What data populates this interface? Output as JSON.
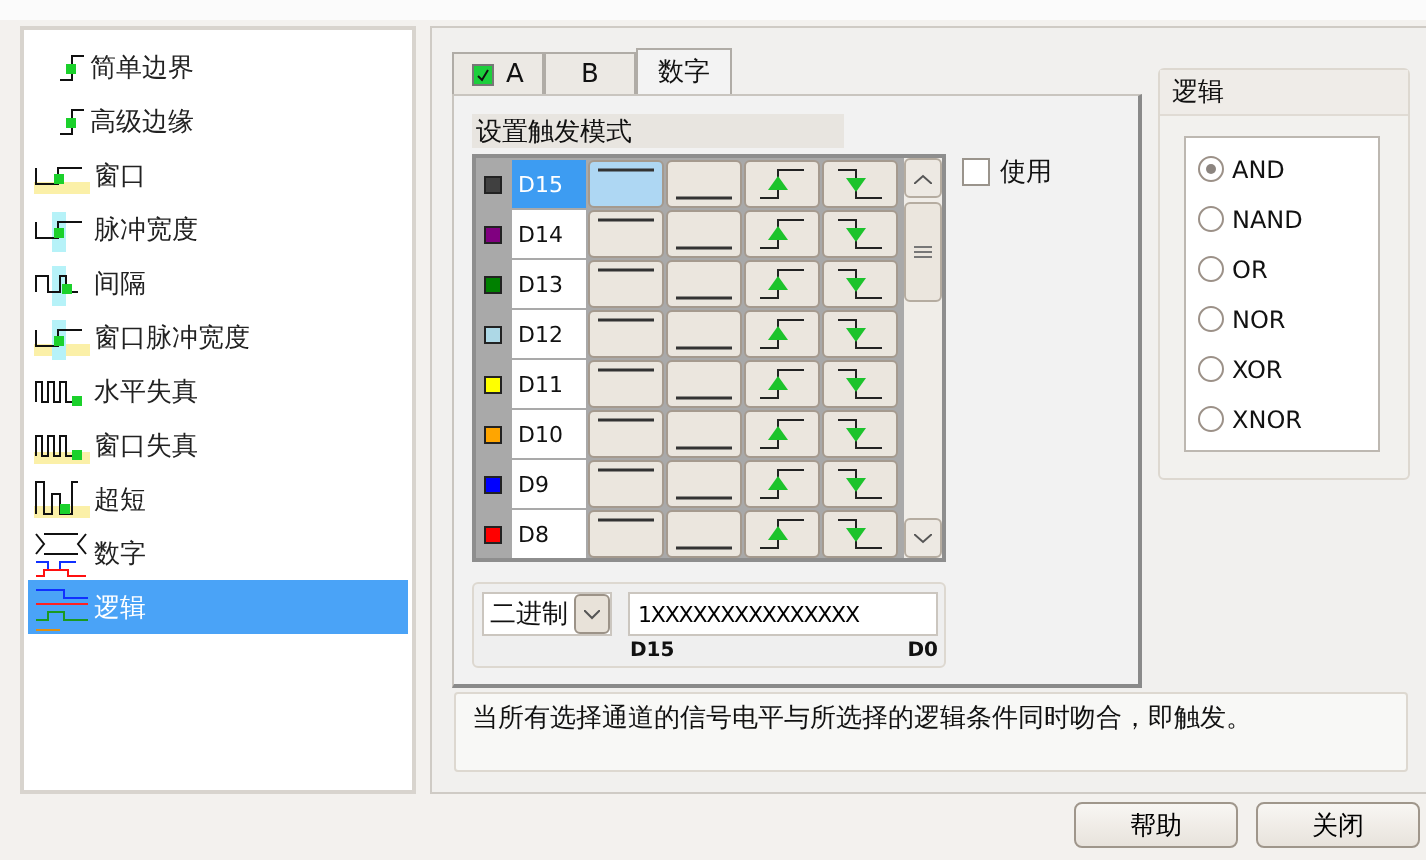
{
  "trigger_types": [
    {
      "label": "简单边界",
      "kind": "edge",
      "selected": false
    },
    {
      "label": "高级边缘",
      "kind": "edge",
      "selected": false
    },
    {
      "label": "窗口",
      "kind": "window",
      "selected": false
    },
    {
      "label": "脉冲宽度",
      "kind": "pulse",
      "selected": false
    },
    {
      "label": "间隔",
      "kind": "interval",
      "selected": false
    },
    {
      "label": "窗口脉冲宽度",
      "kind": "windowpulse",
      "selected": false
    },
    {
      "label": "水平失真",
      "kind": "distortion",
      "selected": false
    },
    {
      "label": "窗口失真",
      "kind": "windowdistortion",
      "selected": false
    },
    {
      "label": "超短",
      "kind": "runt",
      "selected": false
    },
    {
      "label": "数字",
      "kind": "digital",
      "selected": false
    },
    {
      "label": "逻辑",
      "kind": "logic",
      "selected": true
    }
  ],
  "tabs": [
    {
      "label": "A",
      "selected": false,
      "checked": true
    },
    {
      "label": "B",
      "selected": false
    },
    {
      "label": "数字",
      "selected": true
    }
  ],
  "section_title": "设置触发模式",
  "use_checkbox": {
    "label": "使用",
    "checked": false
  },
  "channels": [
    {
      "name": "D15",
      "color": "#404040",
      "selected": true,
      "buttons": [
        {
          "kind": "high",
          "selected": true
        },
        {
          "kind": "low",
          "selected": false
        },
        {
          "kind": "rise",
          "selected": false
        },
        {
          "kind": "fall",
          "selected": false
        }
      ]
    },
    {
      "name": "D14",
      "color": "#800080",
      "selected": false,
      "buttons": [
        {
          "kind": "high",
          "selected": false
        },
        {
          "kind": "low",
          "selected": false
        },
        {
          "kind": "rise",
          "selected": false
        },
        {
          "kind": "fall",
          "selected": false
        }
      ]
    },
    {
      "name": "D13",
      "color": "#008000",
      "selected": false,
      "buttons": [
        {
          "kind": "high",
          "selected": false
        },
        {
          "kind": "low",
          "selected": false
        },
        {
          "kind": "rise",
          "selected": false
        },
        {
          "kind": "fall",
          "selected": false
        }
      ]
    },
    {
      "name": "D12",
      "color": "#add8e6",
      "selected": false,
      "buttons": [
        {
          "kind": "high",
          "selected": false
        },
        {
          "kind": "low",
          "selected": false
        },
        {
          "kind": "rise",
          "selected": false
        },
        {
          "kind": "fall",
          "selected": false
        }
      ]
    },
    {
      "name": "D11",
      "color": "#ffff00",
      "selected": false,
      "buttons": [
        {
          "kind": "high",
          "selected": false
        },
        {
          "kind": "low",
          "selected": false
        },
        {
          "kind": "rise",
          "selected": false
        },
        {
          "kind": "fall",
          "selected": false
        }
      ]
    },
    {
      "name": "D10",
      "color": "#ffa500",
      "selected": false,
      "buttons": [
        {
          "kind": "high",
          "selected": false
        },
        {
          "kind": "low",
          "selected": false
        },
        {
          "kind": "rise",
          "selected": false
        },
        {
          "kind": "fall",
          "selected": false
        }
      ]
    },
    {
      "name": "D9",
      "color": "#0000ff",
      "selected": false,
      "buttons": [
        {
          "kind": "high",
          "selected": false
        },
        {
          "kind": "low",
          "selected": false
        },
        {
          "kind": "rise",
          "selected": false
        },
        {
          "kind": "fall",
          "selected": false
        }
      ]
    },
    {
      "name": "D8",
      "color": "#ff0000",
      "selected": false,
      "buttons": [
        {
          "kind": "high",
          "selected": false
        },
        {
          "kind": "low",
          "selected": false
        },
        {
          "kind": "rise",
          "selected": false
        },
        {
          "kind": "fall",
          "selected": false
        }
      ]
    }
  ],
  "format": {
    "value": "二进制",
    "pattern": "1XXXXXXXXXXXXXXX",
    "start_label": "D15",
    "end_label": "D0"
  },
  "logic": {
    "title": "逻辑",
    "options": [
      {
        "label": "AND",
        "selected": true
      },
      {
        "label": "NAND",
        "selected": false
      },
      {
        "label": "OR",
        "selected": false
      },
      {
        "label": "NOR",
        "selected": false
      },
      {
        "label": "XOR",
        "selected": false
      },
      {
        "label": "XNOR",
        "selected": false
      }
    ]
  },
  "description": "当所有选择通道的信号电平与所选择的逻辑条件同时吻合，即触发。",
  "buttons": [
    "帮助",
    "关闭"
  ]
}
